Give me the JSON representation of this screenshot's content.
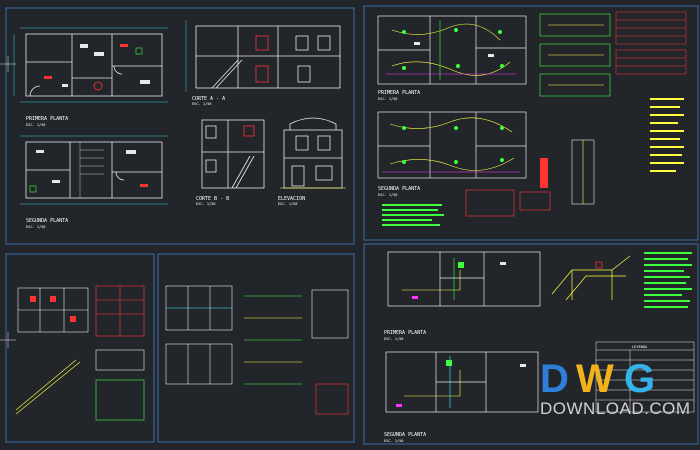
{
  "drawing": {
    "background": "#22262b",
    "sheet_border_color": "#3a6ea8",
    "line_white": "#e8e8e8",
    "line_green": "#3cff3c",
    "line_yellow": "#ffff3c",
    "line_red": "#ff3333",
    "line_cyan": "#33ffff",
    "line_magenta": "#ff33ff",
    "line_blue": "#3355ff"
  },
  "sheet1": {
    "plan1_title": "PRIMERA PLANTA",
    "plan1_scale": "ESC. 1/50",
    "plan2_title": "SEGUNDA PLANTA",
    "plan2_scale": "ESC. 1/50",
    "section_aa_title": "CORTE A - A",
    "section_aa_scale": "ESC. 1/50",
    "section_bb_title": "CORTE B - B",
    "section_bb_scale": "ESC. 1/50",
    "elevation_title": "ELEVACION",
    "elevation_scale": "ESC. 1/50"
  },
  "sheet2": {
    "plan1_title": "PRIMERA PLANTA",
    "plan1_scale": "ESC. 1/50",
    "plan2_title": "SEGUNDA PLANTA",
    "plan2_scale": "ESC. 1/50"
  },
  "sheet4": {
    "plan1_title": "PRIMERA PLANTA",
    "plan1_scale": "ESC. 1/50",
    "plan2_title": "SEGUNDA PLANTA",
    "plan2_scale": "ESC. 1/50",
    "legend_title": "LEYENDA"
  },
  "watermark": {
    "logo_letters": [
      "D",
      "W",
      "G"
    ],
    "logo_colors": [
      "#2f7fd8",
      "#f2b21c",
      "#35b3e8"
    ],
    "text": "DOWNLOAD.COM"
  }
}
